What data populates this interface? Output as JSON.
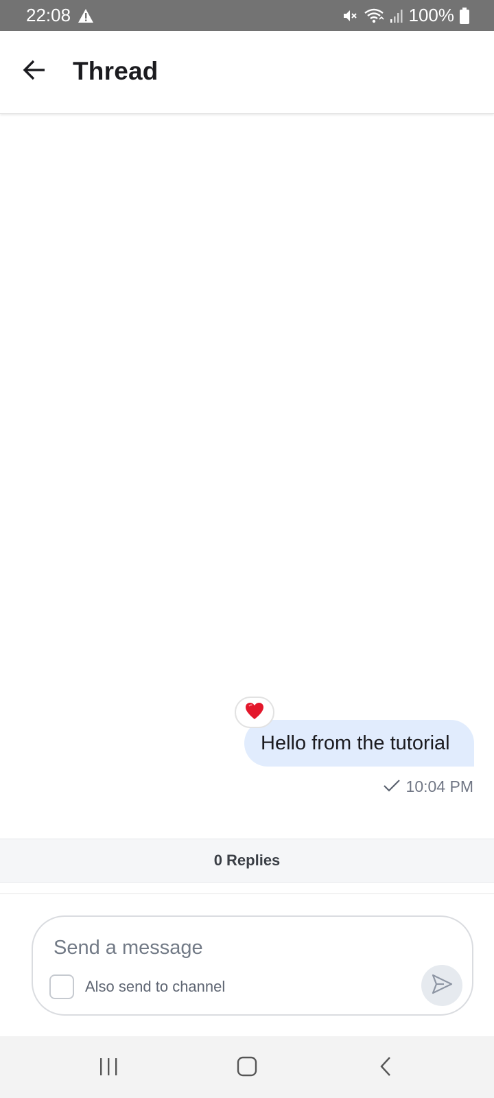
{
  "status_bar": {
    "time": "22:08",
    "battery": "100%",
    "icons": [
      "warning-icon",
      "mute-icon",
      "wifi-icon",
      "signal-icon",
      "battery-icon"
    ]
  },
  "header": {
    "title": "Thread",
    "back_icon": "arrow-left-icon"
  },
  "message": {
    "text": "Hello from the tutorial",
    "reaction": "❤️",
    "time": "10:04 PM",
    "status_icon": "checkmark-icon",
    "bubble_color": "#e1ecfd"
  },
  "replies": {
    "label": "0 Replies"
  },
  "composer": {
    "placeholder": "Send a message",
    "value": "",
    "also_send_label": "Also send to channel",
    "also_send_checked": false,
    "send_icon": "send-icon"
  },
  "nav_bar": {
    "buttons": [
      "recent-apps-icon",
      "home-icon",
      "back-icon"
    ]
  }
}
